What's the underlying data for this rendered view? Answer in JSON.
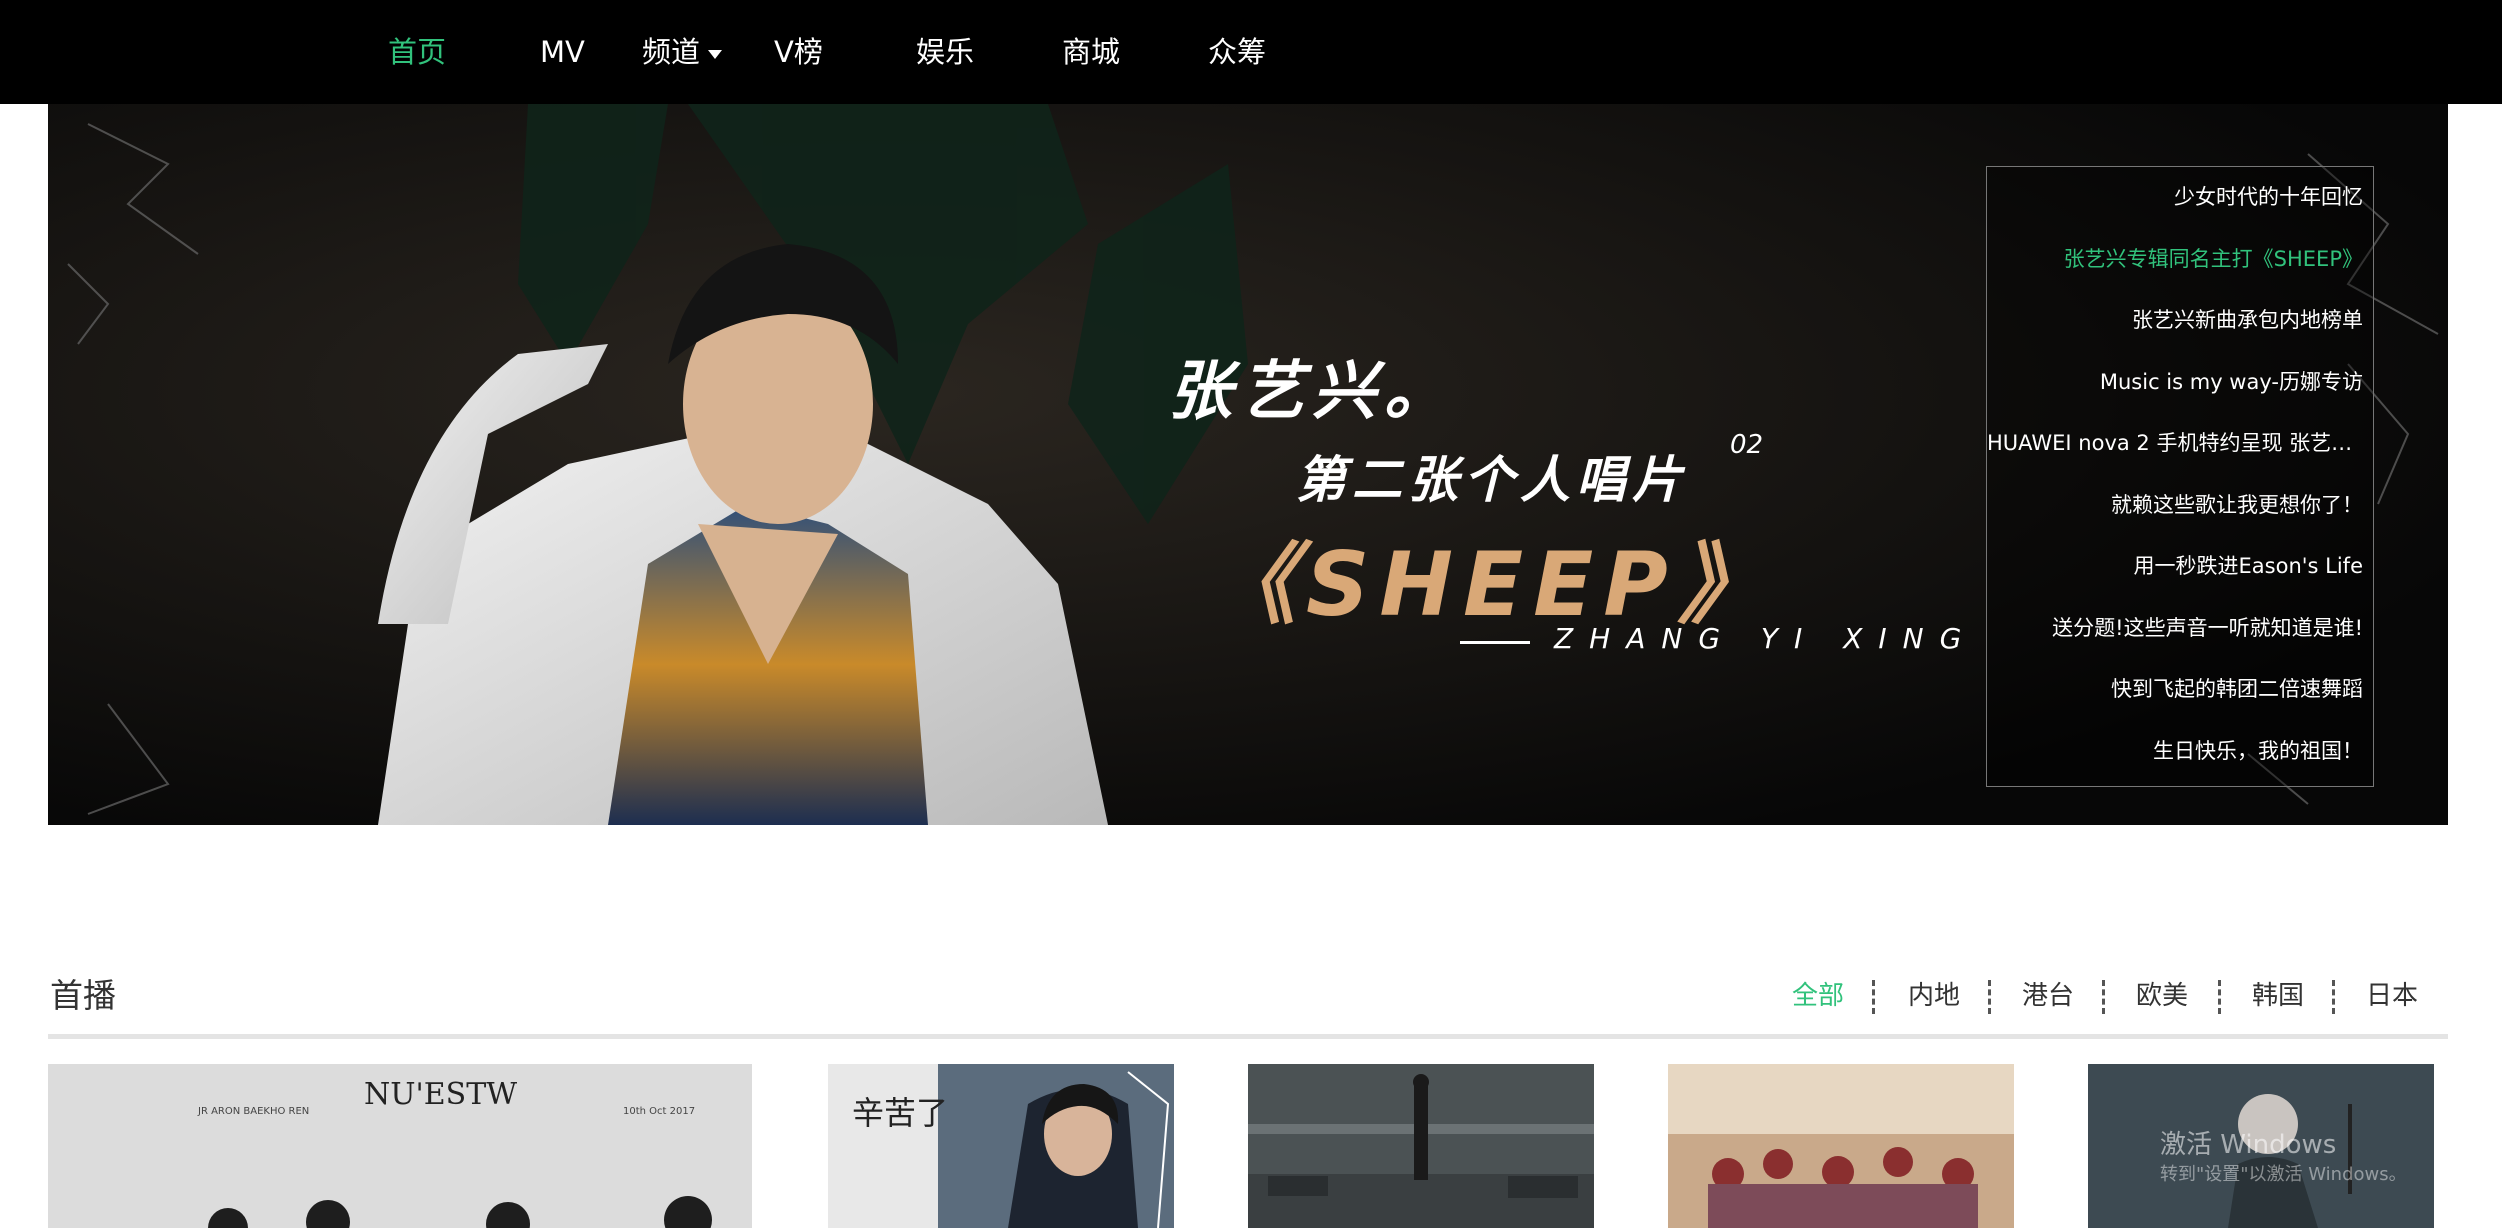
{
  "nav": {
    "items": [
      {
        "label": "首页",
        "active": true
      },
      {
        "label": "MV"
      },
      {
        "label": "频道",
        "dropdown": true
      },
      {
        "label": "V榜"
      },
      {
        "label": "娱乐"
      },
      {
        "label": "商城"
      },
      {
        "label": "众筹"
      }
    ]
  },
  "banner": {
    "line1": "张艺兴。",
    "line2": "第二张个人唱片",
    "line2_sup": "02",
    "line3": "《SHEEP》",
    "line4": "ZHANG YI XING",
    "news": [
      {
        "label": "少女时代的十年回忆"
      },
      {
        "label": "张艺兴专辑同名主打《SHEEP》",
        "active": true
      },
      {
        "label": "张艺兴新曲承包内地榜单"
      },
      {
        "label": "Music is my way-历娜专访"
      },
      {
        "label": "HUAWEI nova 2 手机特约呈现 张艺兴..."
      },
      {
        "label": "就赖这些歌让我更想你了！"
      },
      {
        "label": "用一秒跌进Eason's Life"
      },
      {
        "label": "送分题!这些声音一听就知道是谁!"
      },
      {
        "label": "快到飞起的韩团二倍速舞蹈"
      },
      {
        "label": "生日快乐，我的祖国！"
      }
    ]
  },
  "section": {
    "title": "首播",
    "filters": [
      {
        "label": "全部",
        "active": true
      },
      {
        "label": "内地"
      },
      {
        "label": "港台"
      },
      {
        "label": "欧美"
      },
      {
        "label": "韩国"
      },
      {
        "label": "日本"
      }
    ]
  },
  "cards": [
    {
      "caption": "NU'ESTW",
      "small_left": "JR  ARON  BAEKHO  REN",
      "small_right": "10th Oct 2017"
    },
    {
      "caption": "辛苦了"
    },
    {
      "caption": ""
    },
    {
      "caption": ""
    },
    {
      "caption": ""
    }
  ],
  "watermark": {
    "line1": "激活 Windows",
    "line2": "转到\"设置\"以激活 Windows。"
  },
  "colors": {
    "accent": "#31c27c",
    "topbar": "#000000",
    "banner_gold": "#d9a877"
  }
}
